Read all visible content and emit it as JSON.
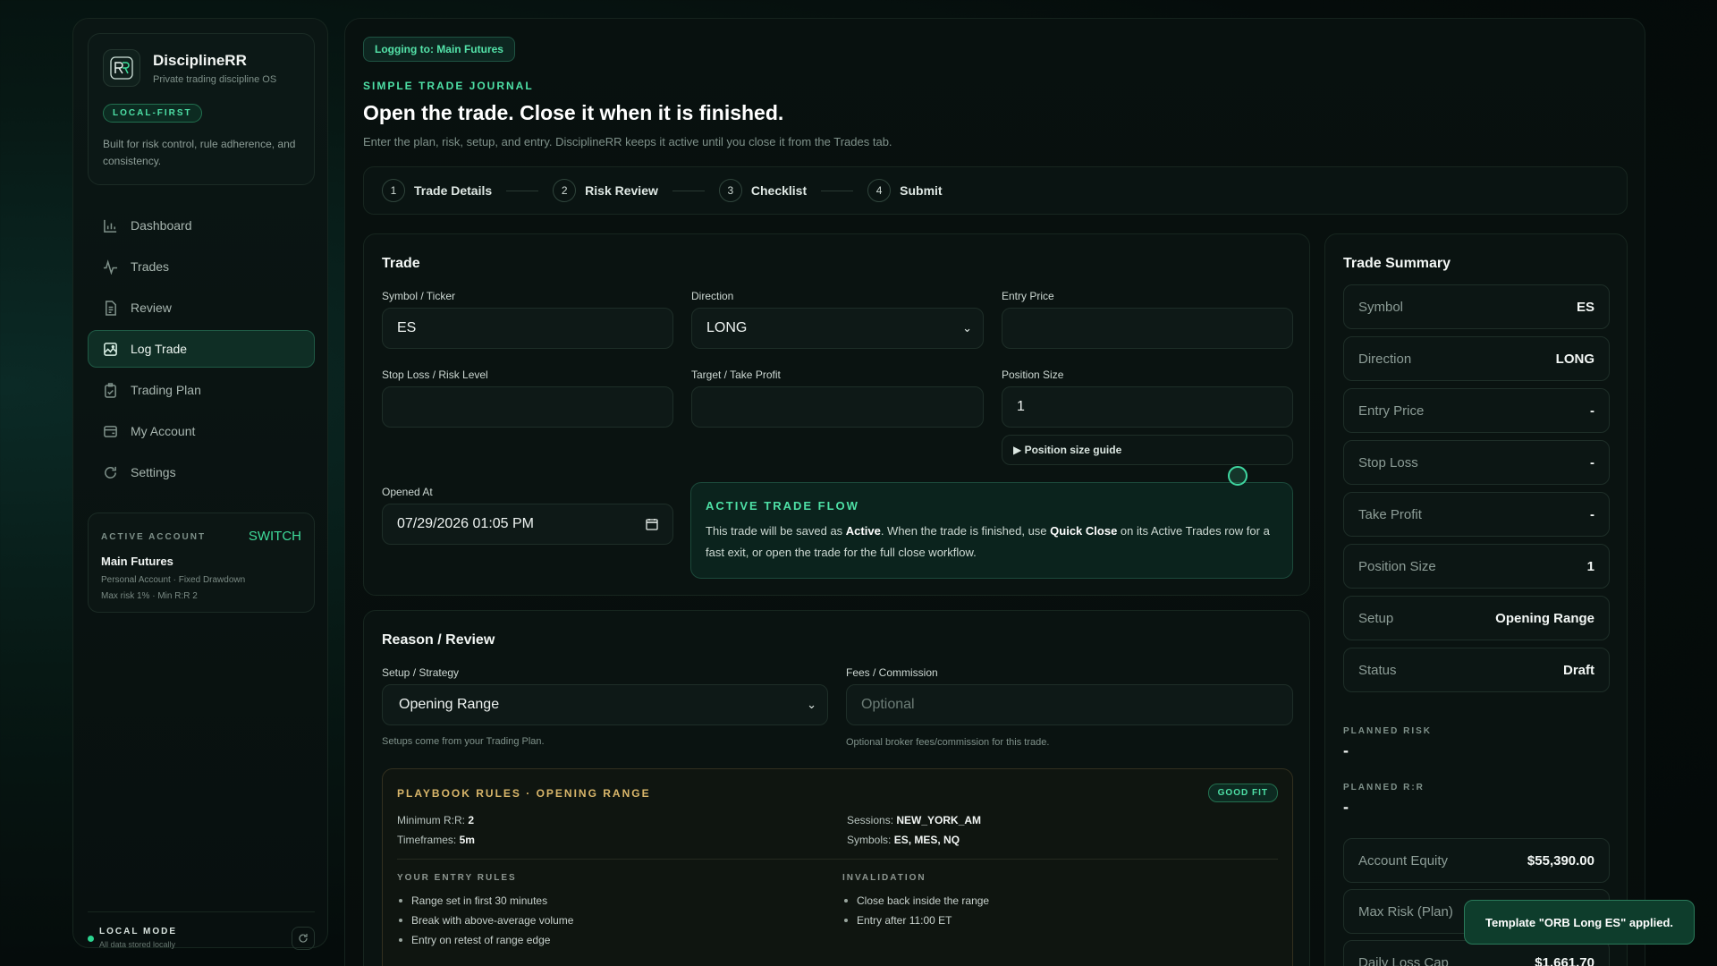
{
  "brand": {
    "name": "DisciplineRR",
    "tagline": "Private trading discipline OS",
    "badge": "LOCAL-FIRST",
    "description": "Built for risk control, rule adherence, and consistency."
  },
  "nav": {
    "items": [
      {
        "label": "Dashboard",
        "icon": "bar-chart-icon"
      },
      {
        "label": "Trades",
        "icon": "activity-icon"
      },
      {
        "label": "Review",
        "icon": "document-icon"
      },
      {
        "label": "Log Trade",
        "icon": "image-chart-icon",
        "active": true
      },
      {
        "label": "Trading Plan",
        "icon": "clipboard-icon"
      },
      {
        "label": "My Account",
        "icon": "wallet-icon"
      },
      {
        "label": "Settings",
        "icon": "refresh-icon"
      }
    ]
  },
  "account": {
    "label": "ACTIVE ACCOUNT",
    "switch_label": "SWITCH",
    "name": "Main Futures",
    "meta1": "Personal Account · Fixed Drawdown",
    "meta2": "Max risk 1% · Min R:R 2"
  },
  "local_mode": {
    "title": "LOCAL MODE",
    "subtitle": "All data stored locally"
  },
  "header": {
    "logging_pill": "Logging to: Main Futures",
    "eyebrow": "SIMPLE TRADE JOURNAL",
    "title": "Open the trade. Close it when it is finished.",
    "subtitle": "Enter the plan, risk, setup, and entry. DisciplineRR keeps it active until you close it from the Trades tab."
  },
  "steps": [
    {
      "num": "1",
      "label": "Trade Details"
    },
    {
      "num": "2",
      "label": "Risk Review"
    },
    {
      "num": "3",
      "label": "Checklist"
    },
    {
      "num": "4",
      "label": "Submit"
    }
  ],
  "trade": {
    "title": "Trade",
    "symbol_label": "Symbol / Ticker",
    "symbol_value": "ES",
    "direction_label": "Direction",
    "direction_value": "LONG",
    "entry_label": "Entry Price",
    "entry_value": "",
    "stop_label": "Stop Loss / Risk Level",
    "stop_value": "",
    "target_label": "Target / Take Profit",
    "target_value": "",
    "size_label": "Position Size",
    "size_value": "1",
    "size_guide": "▶ Position size guide",
    "opened_label": "Opened At",
    "opened_value": "07/29/2026 01:05 PM",
    "flow_title": "ACTIVE TRADE FLOW",
    "flow_pre": "This trade will be saved as ",
    "flow_b1": "Active",
    "flow_mid": ". When the trade is finished, use ",
    "flow_b2": "Quick Close",
    "flow_post": " on its Active Trades row for a fast exit, or open the trade for the full close workflow."
  },
  "reason": {
    "title": "Reason / Review",
    "setup_label": "Setup / Strategy",
    "setup_value": "Opening Range",
    "setup_hint": "Setups come from your Trading Plan.",
    "fees_label": "Fees / Commission",
    "fees_placeholder": "Optional",
    "fees_hint": "Optional broker fees/commission for this trade."
  },
  "playbook": {
    "title": "PLAYBOOK RULES · OPENING RANGE",
    "badge": "GOOD FIT",
    "min_rr_k": "Minimum R:R: ",
    "min_rr_v": "2",
    "timeframes_k": "Timeframes: ",
    "timeframes_v": "5m",
    "sessions_k": "Sessions: ",
    "sessions_v": "NEW_YORK_AM",
    "symbols_k": "Symbols: ",
    "symbols_v": "ES, MES, NQ",
    "entry_rules_title": "YOUR ENTRY RULES",
    "entry_rules": [
      "Range set in first 30 minutes",
      "Break with above-average volume",
      "Entry on retest of range edge"
    ],
    "invalidation_title": "INVALIDATION",
    "invalidation": [
      "Close back inside the range",
      "Entry after 11:00 ET"
    ]
  },
  "summary": {
    "title": "Trade Summary",
    "rows": [
      {
        "k": "Symbol",
        "v": "ES"
      },
      {
        "k": "Direction",
        "v": "LONG"
      },
      {
        "k": "Entry Price",
        "v": "-"
      },
      {
        "k": "Stop Loss",
        "v": "-"
      },
      {
        "k": "Take Profit",
        "v": "-"
      },
      {
        "k": "Position Size",
        "v": "1"
      },
      {
        "k": "Setup",
        "v": "Opening Range"
      },
      {
        "k": "Status",
        "v": "Draft"
      }
    ],
    "planned_risk_label": "PLANNED RISK",
    "planned_risk_value": "-",
    "planned_rr_label": "PLANNED R:R",
    "planned_rr_value": "-",
    "rows2": [
      {
        "k": "Account Equity",
        "v": "$55,390.00"
      },
      {
        "k": "Max Risk (Plan)",
        "v": ""
      },
      {
        "k": "Daily Loss Cap",
        "v": "$1,661.70"
      }
    ]
  },
  "toast": "Template \"ORB Long ES\" applied."
}
